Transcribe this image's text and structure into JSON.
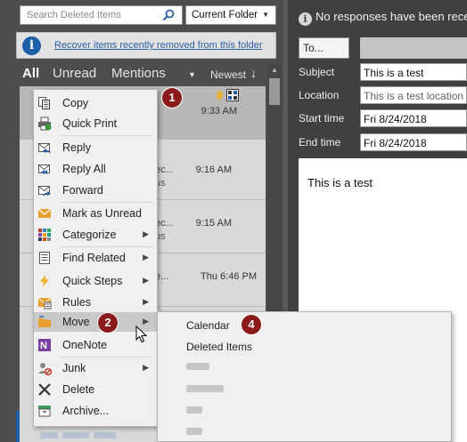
{
  "search": {
    "placeholder": "Search Deleted Items",
    "scope": "Current Folder"
  },
  "infobar": {
    "link": "Recover items recently removed from this folder"
  },
  "filter": {
    "all": "All",
    "unread": "Unread",
    "mentions": "Mentions",
    "newest": "Newest",
    "sort_arrow": "↓"
  },
  "messages": [
    {
      "time": "9:33 AM"
    },
    {
      "snippet": "ec...",
      "snippet2": "us",
      "time": "9:16 AM"
    },
    {
      "snippet": "ec...",
      "snippet2": "us",
      "time": "9:15 AM"
    },
    {
      "snippet": "e...",
      "time": "Thu 6:46 PM"
    }
  ],
  "reading": {
    "no_responses": "No responses have been receive",
    "to_button": "To...",
    "subject_label": "Subject",
    "subject_value": "This is a test",
    "location_label": "Location",
    "location_value": "This is a test location",
    "start_label": "Start time",
    "start_value": "Fri 8/24/2018",
    "end_label": "End time",
    "end_value": "Fri 8/24/2018",
    "body": "This is a test"
  },
  "context_menu": [
    {
      "label": "Copy",
      "icon": "copy-icon"
    },
    {
      "label": "Quick Print",
      "icon": "quick-print-icon"
    },
    {
      "label": "Reply",
      "icon": "reply-icon"
    },
    {
      "label": "Reply All",
      "icon": "reply-all-icon"
    },
    {
      "label": "Forward",
      "icon": "forward-icon"
    },
    {
      "label": "Mark as Unread",
      "icon": "envelope-icon"
    },
    {
      "label": "Categorize",
      "icon": "categorize-icon"
    },
    {
      "label": "Find Related",
      "icon": "find-related-icon"
    },
    {
      "label": "Quick Steps",
      "icon": "lightning-icon"
    },
    {
      "label": "Rules",
      "icon": "rules-icon"
    },
    {
      "label": "Move",
      "icon": "folder-icon"
    },
    {
      "label": "OneNote",
      "icon": "onenote-icon"
    },
    {
      "label": "Junk",
      "icon": "junk-icon"
    },
    {
      "label": "Delete",
      "icon": "delete-icon"
    },
    {
      "label": "Archive...",
      "icon": "archive-icon"
    }
  ],
  "submenu": {
    "items": [
      "Calendar",
      "Deleted Items"
    ]
  },
  "badges": [
    "1",
    "2",
    "4"
  ],
  "colors": {
    "badge": "#8b1a1a",
    "accent": "#1f5fa8",
    "link": "#2b5ea7"
  }
}
